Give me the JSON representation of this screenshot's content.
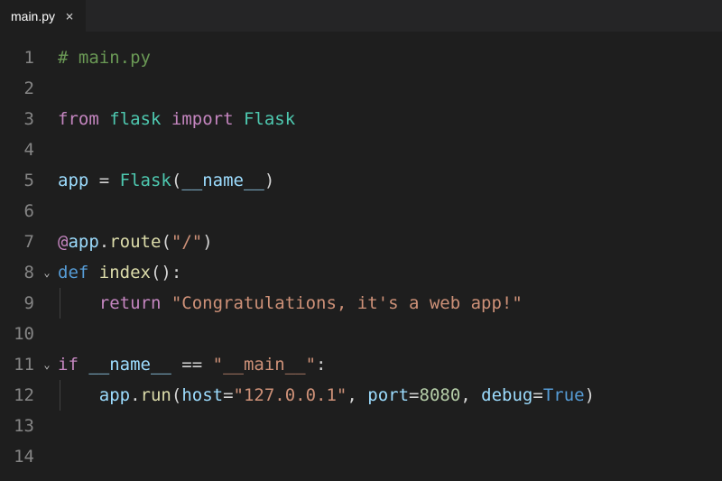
{
  "tab": {
    "filename": "main.py",
    "close_glyph": "×"
  },
  "code": {
    "line_numbers": [
      "1",
      "2",
      "3",
      "4",
      "5",
      "6",
      "7",
      "8",
      "9",
      "10",
      "11",
      "12",
      "13",
      "14"
    ],
    "fold_markers": {
      "8": "⌄",
      "11": "⌄"
    },
    "lines": {
      "l1": {
        "comment": "# main.py"
      },
      "l3": {
        "kw_from": "from",
        "mod": "flask",
        "kw_import": "import",
        "cls": "Flask"
      },
      "l5": {
        "var": "app",
        "eq": " = ",
        "cls": "Flask",
        "lp": "(",
        "dunder": "__name__",
        "rp": ")"
      },
      "l7": {
        "at": "@",
        "obj": "app",
        "dot": ".",
        "method": "route",
        "lp": "(",
        "str": "\"/\"",
        "rp": ")"
      },
      "l8": {
        "kw_def": "def",
        "fname": "index",
        "parens": "():"
      },
      "l9": {
        "indent": "    ",
        "kw_return": "return",
        "str": "\"Congratulations, it's a web app!\""
      },
      "l11": {
        "kw_if": "if",
        "dunder": "__name__",
        "eq": " == ",
        "str": "\"__main__\"",
        "colon": ":"
      },
      "l12": {
        "indent": "    ",
        "obj": "app",
        "dot": ".",
        "method": "run",
        "lp": "(",
        "p1": "host",
        "eq1": "=",
        "s1": "\"127.0.0.1\"",
        "c1": ", ",
        "p2": "port",
        "eq2": "=",
        "n2": "8080",
        "c2": ", ",
        "p3": "debug",
        "eq3": "=",
        "v3": "True",
        "rp": ")"
      }
    }
  }
}
